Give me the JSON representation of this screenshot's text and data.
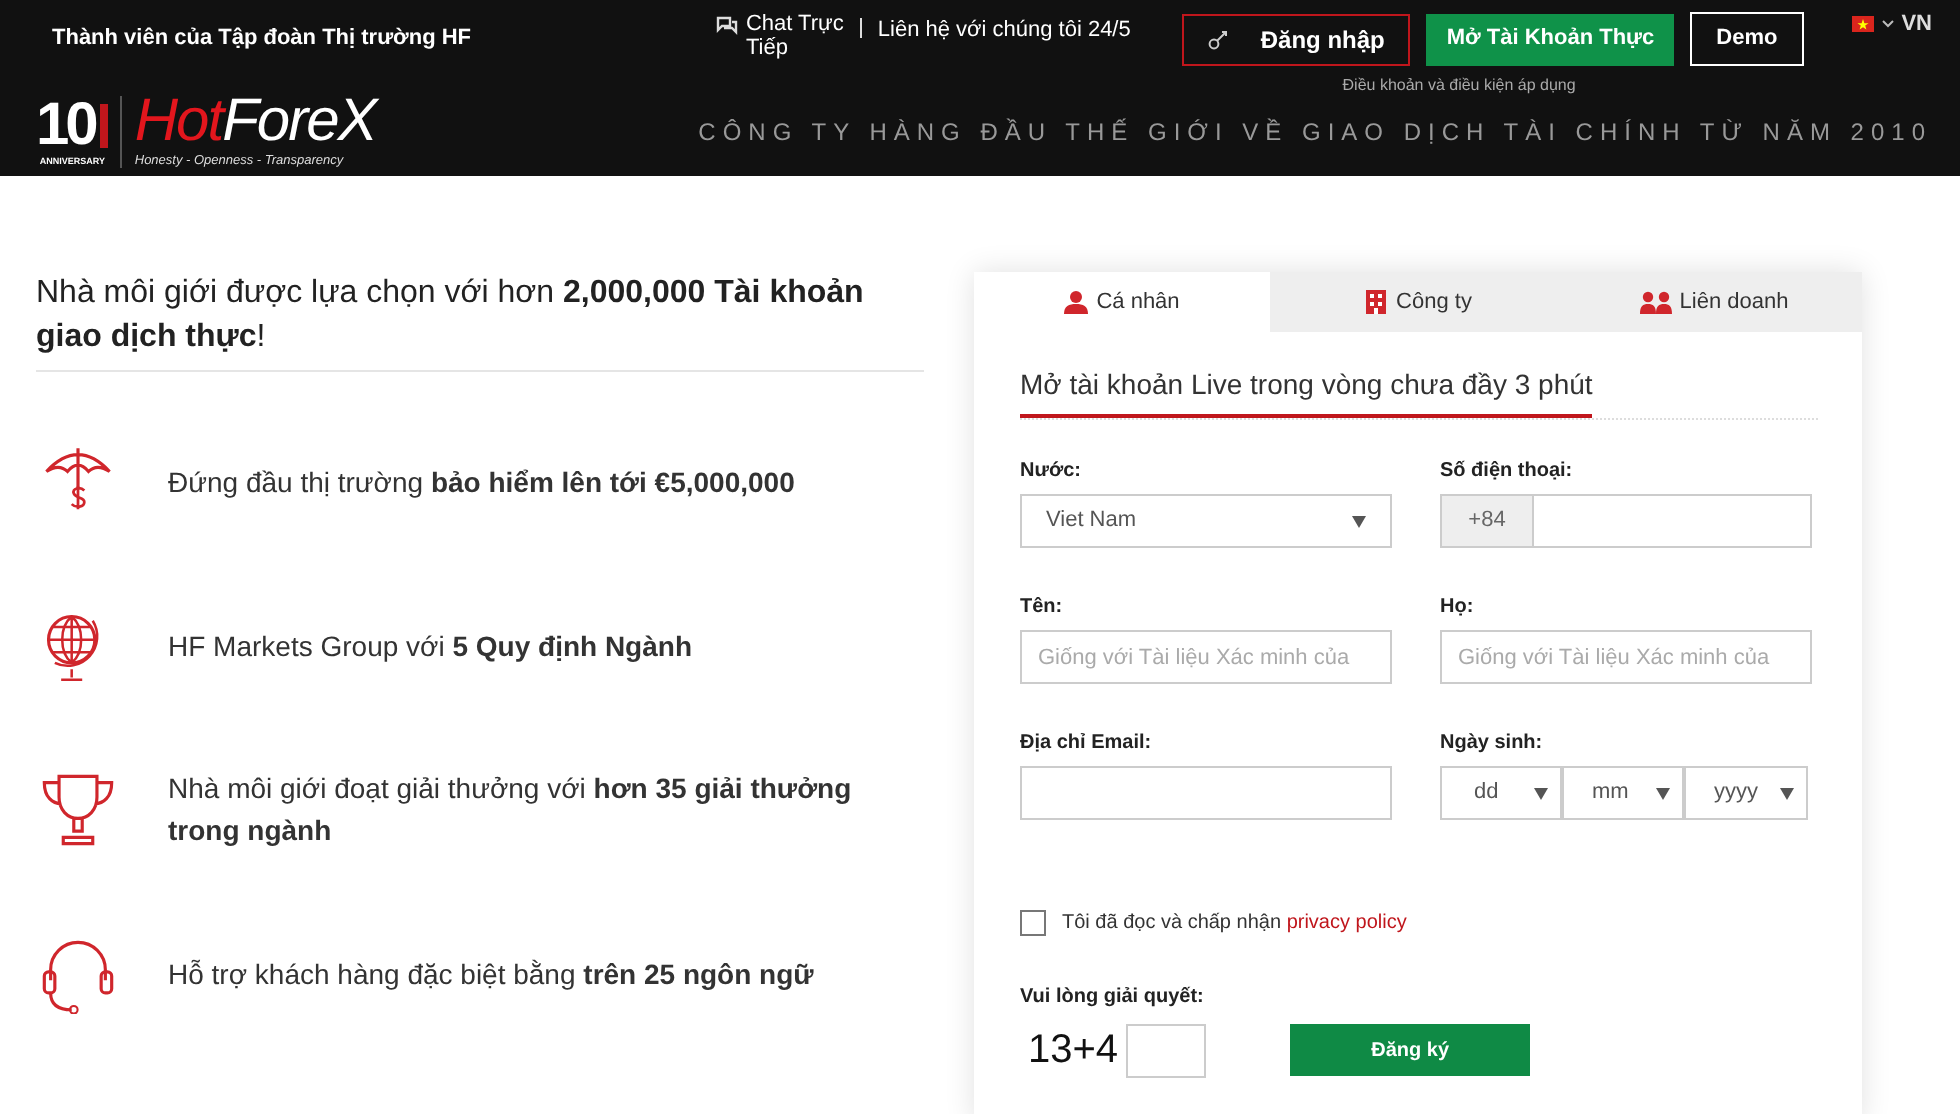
{
  "topbar": {
    "member_text": "Thành viên của Tập đoàn Thị trường HF",
    "chat_lines": [
      "Chat Trực",
      "Tiếp"
    ],
    "contact": "Liên hệ với chúng tôi 24/5",
    "login": "Đăng nhập",
    "open_account": "Mở Tài Khoản Thực",
    "terms": "Điều khoản và điều kiện áp dụng",
    "demo": "Demo",
    "language": "VN"
  },
  "logo": {
    "number": "10",
    "caption": "ANNIVERSARY",
    "brand_hot": "Hot",
    "brand_forex": "ForeX",
    "tagline": "Honesty - Openness - Transparency"
  },
  "slogan": "CÔNG TY HÀNG ĐẦU THẾ GIỚI VỀ GIAO DỊCH TÀI CHÍNH TỪ NĂM 2010",
  "headline": "Nhà môi giới được lựa chọn với hơn **2,000,000 Tài khoản giao dịch thực**!",
  "features": [
    {
      "kind": "umbrella",
      "text": "Đứng đầu thị trường **bảo hiểm lên tới €5,000,000**"
    },
    {
      "kind": "globe",
      "text": "HF Markets Group với **5 Quy định Ngành**"
    },
    {
      "kind": "trophy",
      "text": "Nhà môi giới đoạt giải thưởng với **hơn 35 giải thưởng trong ngành**"
    },
    {
      "kind": "headset",
      "text": "Hỗ trợ khách hàng đặc biệt bằng **trên 25 ngôn ngữ**"
    }
  ],
  "form": {
    "tabs": [
      {
        "label": "Cá nhân",
        "kind": "person",
        "selected": true
      },
      {
        "label": "Công ty",
        "kind": "building",
        "selected": false
      },
      {
        "label": "Liên doanh",
        "kind": "people",
        "selected": false
      }
    ],
    "title": "Mở tài khoản Live trong vòng chưa đầy 3 phút",
    "fields": [
      {
        "kind": "select",
        "label": "Nước:",
        "value": "Viet Nam"
      },
      {
        "kind": "phone",
        "label": "Số điện thoại:",
        "prefix": "+84"
      },
      {
        "kind": "text",
        "label": "Tên:",
        "placeholder": "Giống với Tài liệu Xác minh của"
      },
      {
        "kind": "text",
        "label": "Họ:",
        "placeholder": "Giống với Tài liệu Xác minh của"
      },
      {
        "kind": "text",
        "label": "Địa chỉ Email:"
      },
      {
        "kind": "date",
        "label": "Ngày sinh:",
        "parts": [
          "dd",
          "mm",
          "yyyy"
        ]
      }
    ],
    "agree": {
      "checked": false,
      "text": "Tôi đã đọc và chấp nhận",
      "link": "privacy policy"
    },
    "captcha_label": "Vui lòng giải quyết:",
    "captcha": "13+4",
    "submit": "Đăng ký"
  }
}
